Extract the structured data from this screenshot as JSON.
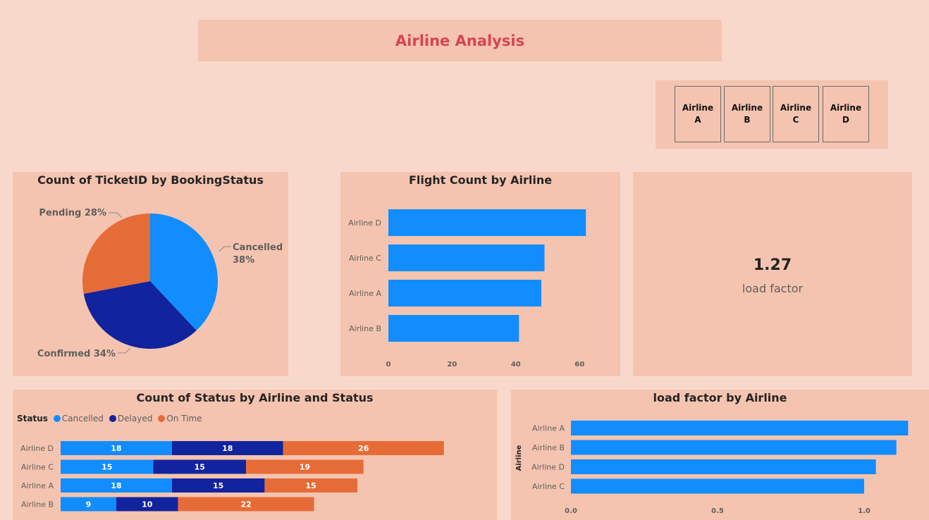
{
  "header": {
    "title": "Airline Analysis"
  },
  "slicer": {
    "items": [
      "Airline A",
      "Airline B",
      "Airline C",
      "Airline D"
    ]
  },
  "colors": {
    "cancelled": "#118dff",
    "confirmed": "#12239e",
    "pending": "#e66c37",
    "bar": "#118dff",
    "title": "#d64550"
  },
  "kpi": {
    "value": "1.27",
    "label": "load factor"
  },
  "chart_data": [
    {
      "id": "pie",
      "type": "pie",
      "title": "Count of TicketID by BookingStatus",
      "slices": [
        {
          "label": "Cancelled",
          "percent_label": "38%",
          "value": 38
        },
        {
          "label": "Confirmed",
          "percent_label": "34%",
          "value": 34
        },
        {
          "label": "Pending",
          "percent_label": "28%",
          "value": 28
        }
      ]
    },
    {
      "id": "flight_count",
      "type": "bar",
      "orientation": "horizontal",
      "title": "Flight Count by Airline",
      "categories": [
        "Airline D",
        "Airline C",
        "Airline A",
        "Airline B"
      ],
      "values": [
        62,
        49,
        48,
        41
      ],
      "xlim": [
        0,
        70
      ],
      "xticks": [
        0,
        20,
        40,
        60
      ],
      "grid": false
    },
    {
      "id": "status_stacked",
      "type": "bar",
      "orientation": "horizontal",
      "stacked": true,
      "title": "Count of Status by Airline and Status",
      "legend_title": "Status",
      "legend_position": "top-left",
      "categories": [
        "Airline D",
        "Airline C",
        "Airline A",
        "Airline B"
      ],
      "series": [
        {
          "name": "Cancelled",
          "values": [
            18,
            15,
            18,
            9
          ]
        },
        {
          "name": "Delayed",
          "values": [
            18,
            15,
            15,
            10
          ]
        },
        {
          "name": "On Time",
          "values": [
            26,
            19,
            15,
            22
          ]
        }
      ],
      "xlim": [
        0,
        70
      ]
    },
    {
      "id": "load_factor",
      "type": "bar",
      "orientation": "horizontal",
      "title": "load factor by Airline",
      "ylabel": "Airline",
      "categories": [
        "Airline A",
        "Airline B",
        "Airline D",
        "Airline C"
      ],
      "values": [
        1.15,
        1.11,
        1.04,
        1.0
      ],
      "xlim": [
        0,
        1.2
      ],
      "xticks": [
        "0.0",
        "0.5",
        "1.0"
      ]
    }
  ]
}
